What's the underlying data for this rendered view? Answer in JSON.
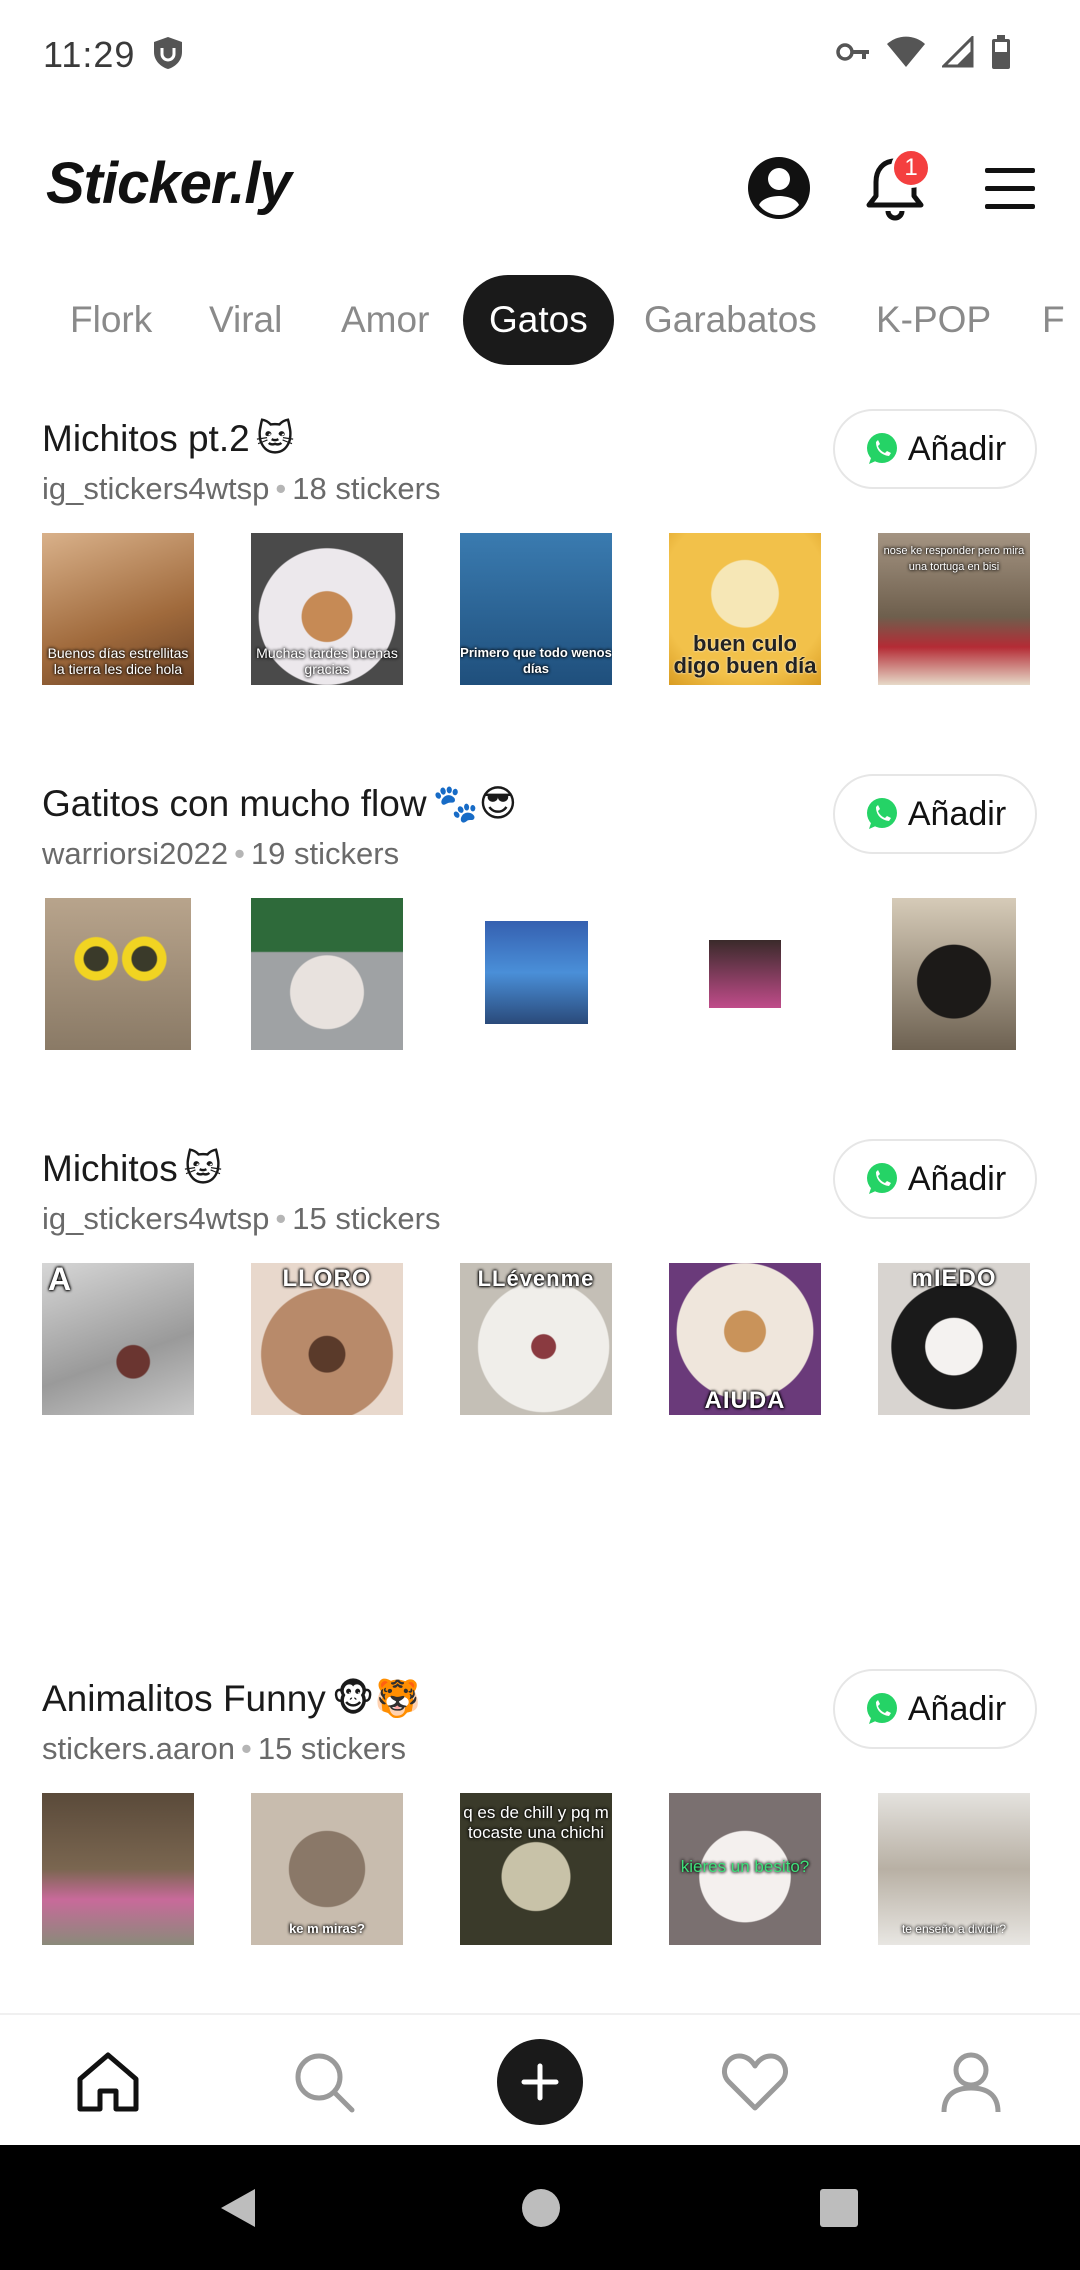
{
  "status_bar": {
    "time": "11:29",
    "icons": [
      "shield-icon",
      "key-icon",
      "wifi-icon",
      "signal-icon",
      "battery-icon"
    ]
  },
  "header": {
    "logo": "Sticker.ly",
    "notification_count": "1",
    "icons": [
      "account-icon",
      "bell-icon",
      "menu-icon"
    ]
  },
  "tabs": [
    {
      "label": "Flork",
      "active": false
    },
    {
      "label": "Viral",
      "active": false
    },
    {
      "label": "Amor",
      "active": false
    },
    {
      "label": "Gatos",
      "active": true
    },
    {
      "label": "Garabatos",
      "active": false
    },
    {
      "label": "K-POP",
      "active": false
    },
    {
      "label": "F",
      "active": false
    }
  ],
  "packs": [
    {
      "title": "Michitos pt.2",
      "title_emoji": "🐱",
      "author": "ig_stickers4wtsp",
      "separator": "•",
      "count": "18 stickers",
      "add_label": "Añadir",
      "captions": [
        "Buenos días estrellitas la tierra les dice hola",
        "Muchas tardes buenas gracias",
        "Primero que todo wenos días",
        "buen culo digo buen día",
        "nose ke responder pero mira una tortuga en bisi"
      ]
    },
    {
      "title": "Gatitos con mucho flow",
      "title_emoji": "🐾😎",
      "author": "warriorsi2022",
      "separator": "•",
      "count": "19 stickers",
      "add_label": "Añadir",
      "captions": [
        "",
        "",
        "",
        "",
        ""
      ]
    },
    {
      "title": "Michitos",
      "title_emoji": "🐱",
      "author": "ig_stickers4wtsp",
      "separator": "•",
      "count": "15 stickers",
      "add_label": "Añadir",
      "captions": [
        "A",
        "LLORO",
        "LLévenme",
        "AIUDA",
        "mIEDO"
      ]
    },
    {
      "title": "Animalitos Funny",
      "title_emoji": "🐵🐯",
      "author": "stickers.aaron",
      "separator": "•",
      "count": "15 stickers",
      "add_label": "Añadir",
      "captions": [
        "",
        "ke m miras?",
        "q es de chill y pq m tocaste una chichi",
        "kieres un besito?",
        "te enseño a dividir?"
      ]
    }
  ],
  "bottom_nav": [
    "home-icon",
    "search-icon",
    "create-icon",
    "favorites-icon",
    "profile-icon"
  ],
  "colors": {
    "accent_dark": "#1a1a1a",
    "badge_red": "#f43f3f",
    "whatsapp_green": "#25d366",
    "tab_inactive": "#8a8a8a"
  }
}
